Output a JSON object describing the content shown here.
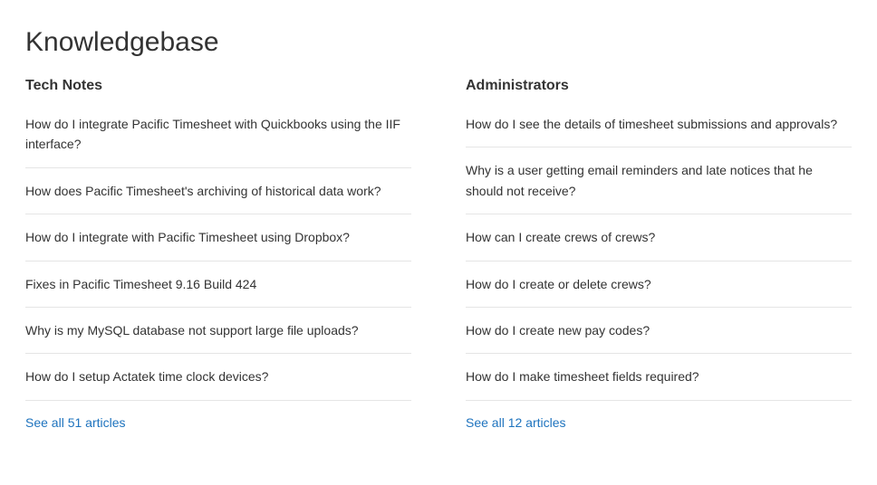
{
  "page_title": "Knowledgebase",
  "sections": [
    {
      "title": "Tech Notes",
      "articles": [
        "How do I integrate Pacific Timesheet with Quickbooks using the IIF interface?",
        "How does Pacific Timesheet's archiving of historical data work?",
        "How do I integrate with Pacific Timesheet using Dropbox?",
        "Fixes in Pacific Timesheet 9.16 Build 424",
        "Why is my MySQL database not support large file uploads?",
        "How do I setup Actatek time clock devices?"
      ],
      "see_all": "See all 51 articles"
    },
    {
      "title": "Administrators",
      "articles": [
        "How do I see the details of timesheet submissions and approvals?",
        "Why is a user getting email reminders and late notices that he should not receive?",
        "How can I create crews of crews?",
        "How do I create or delete crews?",
        "How do I create new pay codes?",
        "How do I make timesheet fields required?"
      ],
      "see_all": "See all 12 articles"
    }
  ]
}
